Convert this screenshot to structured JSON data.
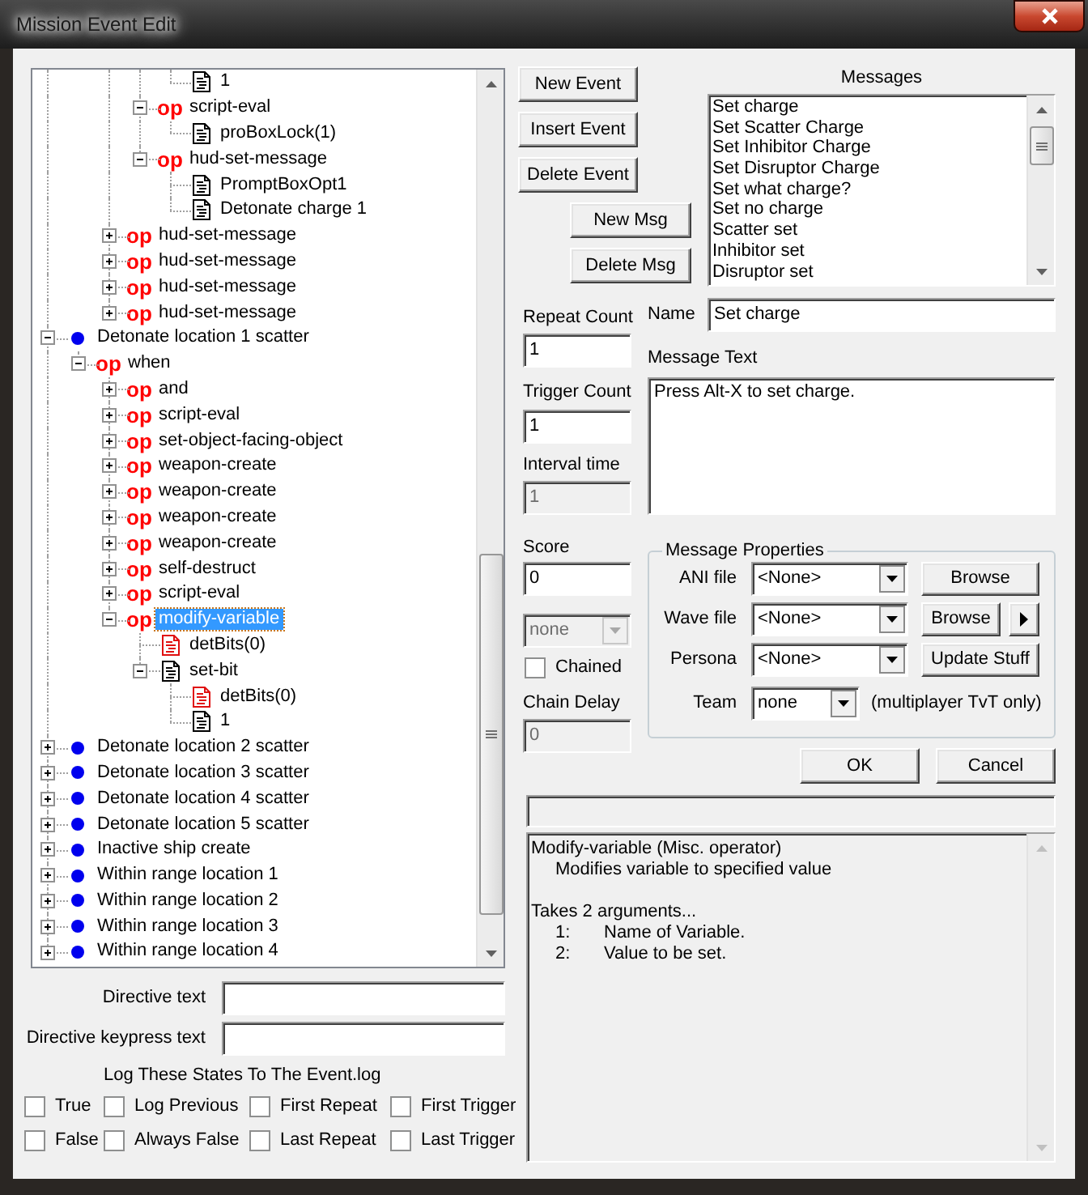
{
  "window": {
    "title": "Mission Event Edit"
  },
  "tree": {
    "items": [
      {
        "children": [
          {
            "children": [
              {
                "children": [
                  {
                    "children": [
                      {
                        "kind": "data",
                        "label": "1",
                        "selected": false
                      }
                    ]
                  },
                  {
                    "kind": "operator",
                    "tag": "op",
                    "label": "script-eval",
                    "expanded": true,
                    "selected": false,
                    "children": [
                      {
                        "kind": "data",
                        "label": "proBoxLock(1)",
                        "selected": false
                      }
                    ]
                  },
                  {
                    "kind": "operator",
                    "tag": "op",
                    "label": "hud-set-message",
                    "expanded": true,
                    "selected": false,
                    "children": [
                      {
                        "kind": "data",
                        "label": "PromptBoxOpt1",
                        "selected": false
                      },
                      {
                        "kind": "data",
                        "label": "Detonate charge 1",
                        "selected": false
                      }
                    ]
                  }
                ]
              },
              {
                "kind": "operator",
                "tag": "op",
                "label": "hud-set-message",
                "expanded": false,
                "selected": false
              },
              {
                "kind": "operator",
                "tag": "op",
                "label": "hud-set-message",
                "expanded": false,
                "selected": false
              },
              {
                "kind": "operator",
                "tag": "op",
                "label": "hud-set-message",
                "expanded": false,
                "selected": false
              },
              {
                "kind": "operator",
                "tag": "op",
                "label": "hud-set-message",
                "expanded": false,
                "selected": false
              }
            ]
          }
        ]
      },
      {
        "kind": "event",
        "label": "Detonate location 1 scatter",
        "expanded": true,
        "selected": false,
        "children": [
          {
            "kind": "operator",
            "tag": "op",
            "label": "when",
            "expanded": true,
            "selected": false,
            "children": [
              {
                "kind": "operator",
                "tag": "op",
                "label": "and",
                "expanded": false,
                "selected": false
              },
              {
                "kind": "operator",
                "tag": "op",
                "label": "script-eval",
                "expanded": false,
                "selected": false
              },
              {
                "kind": "operator",
                "tag": "op",
                "label": "set-object-facing-object",
                "expanded": false,
                "selected": false
              },
              {
                "kind": "operator",
                "tag": "op",
                "label": "weapon-create",
                "expanded": false,
                "selected": false
              },
              {
                "kind": "operator",
                "tag": "op",
                "label": "weapon-create",
                "expanded": false,
                "selected": false
              },
              {
                "kind": "operator",
                "tag": "op",
                "label": "weapon-create",
                "expanded": false,
                "selected": false
              },
              {
                "kind": "operator",
                "tag": "op",
                "label": "weapon-create",
                "expanded": false,
                "selected": false
              },
              {
                "kind": "operator",
                "tag": "op",
                "label": "self-destruct",
                "expanded": false,
                "selected": false
              },
              {
                "kind": "operator",
                "tag": "op",
                "label": "script-eval",
                "expanded": false,
                "selected": false
              },
              {
                "kind": "operator",
                "tag": "op",
                "label": "modify-variable",
                "expanded": true,
                "selected": true,
                "children": [
                  {
                    "kind": "variable",
                    "label": "detBits(0)",
                    "selected": false
                  },
                  {
                    "kind": "data",
                    "label": "set-bit",
                    "expanded": true,
                    "selected": false,
                    "children": [
                      {
                        "kind": "variable",
                        "label": "detBits(0)",
                        "selected": false
                      },
                      {
                        "kind": "data",
                        "label": "1",
                        "selected": false
                      }
                    ]
                  }
                ]
              }
            ]
          }
        ]
      },
      {
        "kind": "event",
        "label": "Detonate location 2 scatter",
        "expanded": false,
        "selected": false
      },
      {
        "kind": "event",
        "label": "Detonate location 3 scatter",
        "expanded": false,
        "selected": false
      },
      {
        "kind": "event",
        "label": "Detonate location 4 scatter",
        "expanded": false,
        "selected": false
      },
      {
        "kind": "event",
        "label": "Detonate location 5 scatter",
        "expanded": false,
        "selected": false
      },
      {
        "kind": "event",
        "label": "Inactive ship create",
        "expanded": false,
        "selected": false
      },
      {
        "kind": "event",
        "label": "Within range location 1",
        "expanded": false,
        "selected": false
      },
      {
        "kind": "event",
        "label": "Within range location 2",
        "expanded": false,
        "selected": false
      },
      {
        "kind": "event",
        "label": "Within range location 3",
        "expanded": false,
        "selected": false
      },
      {
        "kind": "event",
        "label": "Within range location 4",
        "expanded": false,
        "selected": false
      }
    ]
  },
  "directive_fields": [
    {
      "label": "Directive text"
    },
    {
      "label": "Directive keypress text"
    }
  ],
  "log_states": {
    "title": "Log These States To The Event.log",
    "options": [
      {
        "label": "True",
        "checked": false
      },
      {
        "label": "Log Previous",
        "checked": false
      },
      {
        "label": "First Repeat",
        "checked": false
      },
      {
        "label": "First Trigger",
        "checked": false
      },
      {
        "label": "False",
        "checked": false
      },
      {
        "label": "Always False",
        "checked": false
      },
      {
        "label": "Last Repeat",
        "checked": false
      },
      {
        "label": "Last Trigger",
        "checked": false
      }
    ]
  },
  "event_buttons": [
    "New Event",
    "Insert Event",
    "Delete Event"
  ],
  "message_buttons": [
    "New Msg",
    "Delete Msg"
  ],
  "messages": {
    "title": "Messages",
    "items": [
      {
        "label": "Set charge",
        "selected": false
      },
      {
        "label": "Set Scatter Charge",
        "selected": false
      },
      {
        "label": "Set Inhibitor Charge",
        "selected": false
      },
      {
        "label": "Set Disruptor Charge",
        "selected": false
      },
      {
        "label": "Set what charge?",
        "selected": false
      },
      {
        "label": "Set no charge",
        "selected": false
      },
      {
        "label": "Scatter set",
        "selected": false
      },
      {
        "label": "Inhibitor set",
        "selected": false
      },
      {
        "label": "Disruptor set",
        "selected": false
      }
    ]
  },
  "counters": [
    {
      "label": "Repeat Count",
      "value": "1",
      "disabled": false
    },
    {
      "label": "Trigger Count",
      "value": "1",
      "disabled": false
    },
    {
      "label": "Interval time",
      "value": "1",
      "disabled": true
    }
  ],
  "name": {
    "label": "Name",
    "value": "Set charge"
  },
  "message_text": {
    "label": "Message Text",
    "value": "Press Alt-X to set charge."
  },
  "score": {
    "label": "Score",
    "value": "0",
    "disabled": false
  },
  "combo_box": {
    "value": "none",
    "disabled": true
  },
  "chained": {
    "label": "Chained",
    "checked": false
  },
  "chain_delay": {
    "label": "Chain Delay",
    "value": "0",
    "disabled": true
  },
  "message_properties": {
    "title": "Message Properties",
    "rows": [
      {
        "kind": "button",
        "label": "ANI file",
        "value": "<None>",
        "button": "Browse"
      },
      {
        "kind": "button_play",
        "label": "Wave file",
        "value": "<None>",
        "button": "Browse"
      },
      {
        "kind": "button",
        "label": "Persona",
        "value": "<None>",
        "button": "Update Stuff"
      },
      {
        "kind": "note",
        "label": "Team",
        "value": "none",
        "note": "(multiplayer TvT only)"
      }
    ]
  },
  "dialog_buttons": [
    "OK",
    "Cancel"
  ],
  "help": {
    "title": "Modify-variable (Misc. operator)",
    "summary": "Modifies variable to specified value",
    "intro": "Takes 2 arguments...",
    "arguments": [
      {
        "number": "1:",
        "text": "Name of Variable."
      },
      {
        "number": "2:",
        "text": "Value to be set."
      }
    ]
  }
}
